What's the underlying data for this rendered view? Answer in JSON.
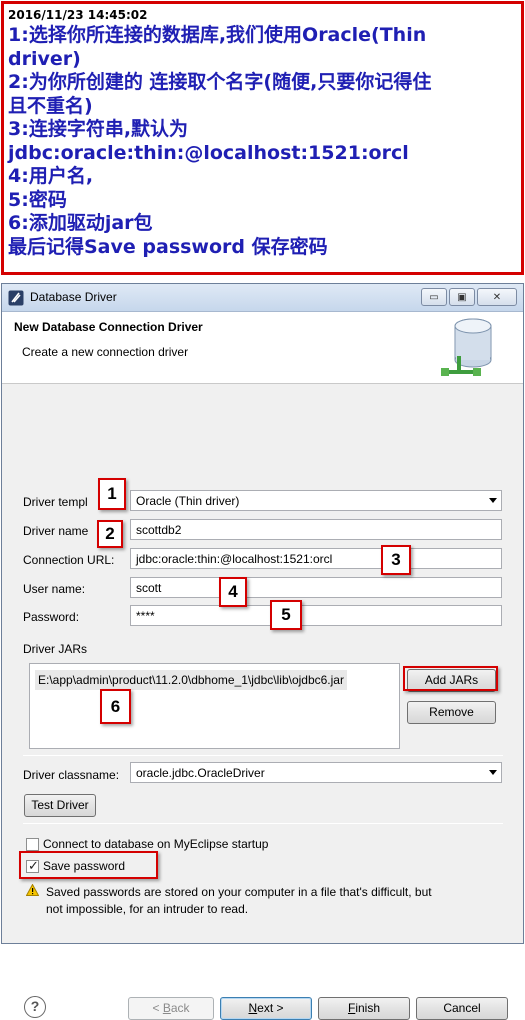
{
  "annotation": {
    "timestamp": "2016/11/23 14:45:02",
    "lines": [
      "1:选择你所连接的数据库,我们使用Oracle(Thin",
      "driver)",
      "2:为你所创建的 连接取个名字(随便,只要你记得住",
      "且不重名)",
      "3:连接字符串,默认为",
      "jdbc:oracle:thin:@localhost:1521:orcl",
      "4:用户名,",
      "5:密码",
      "6:添加驱动jar包",
      "最后记得Save password 保存密码"
    ]
  },
  "window": {
    "title": "Database Driver",
    "controls": {
      "minimize": "▭",
      "maximize": "▣",
      "close": "✕"
    }
  },
  "header": {
    "title": "New Database Connection Driver",
    "description": "Create a new connection driver"
  },
  "form": {
    "driver_template_label": "Driver templ",
    "driver_template_value": "Oracle (Thin driver)",
    "driver_name_label": "Driver name",
    "driver_name_value": "scottdb2",
    "connection_url_label": "Connection URL:",
    "connection_url_value": "jdbc:oracle:thin:@localhost:1521:orcl",
    "user_name_label": "User name:",
    "user_name_value": "scott",
    "password_label": "Password:",
    "password_value": "****",
    "driver_jars_label": "Driver JARs",
    "jars": [
      "E:\\app\\admin\\product\\11.2.0\\dbhome_1\\jdbc\\lib\\ojdbc6.jar"
    ],
    "add_jars_label": "Add JARs",
    "remove_label": "Remove",
    "classname_label": "Driver classname:",
    "classname_value": "oracle.jdbc.OracleDriver",
    "test_driver_label": "Test Driver",
    "connect_on_startup_label": "Connect to database on MyEclipse startup",
    "connect_on_startup_checked": false,
    "save_password_label": "Save password",
    "save_password_checked": true,
    "warning_line1": "Saved passwords are stored on your computer in a file that's difficult, but",
    "warning_line2": "not impossible, for an intruder to read."
  },
  "footer": {
    "back_label": "< Back",
    "next_label": "Next >",
    "finish_label": "Finish",
    "cancel_label": "Cancel",
    "help_symbol": "?"
  },
  "callouts": [
    "1",
    "2",
    "3",
    "4",
    "5",
    "6"
  ],
  "colors": {
    "annotation_red": "#d40000",
    "annotation_blue": "#1f1fb3"
  }
}
